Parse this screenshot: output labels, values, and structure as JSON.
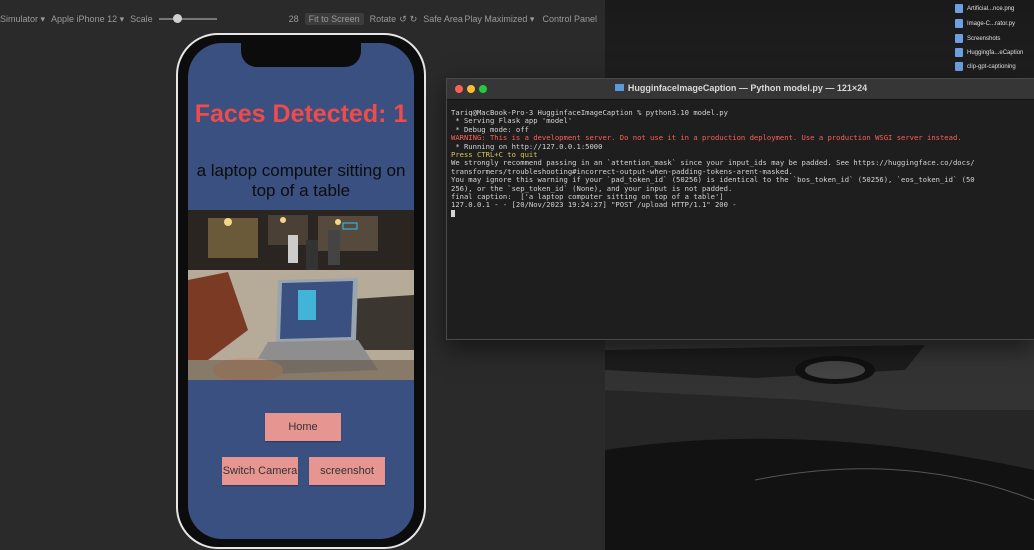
{
  "editor_toolbar": {
    "simulator_label": "Simulator ▾",
    "device_label": "Apple iPhone 12 ▾",
    "scale_label": "Scale",
    "scale_value": "28",
    "fit_label": "Fit to Screen",
    "rotate_label": "Rotate",
    "safe_area_label": "Safe Area",
    "play_mode_label": "Play Maximized ▾",
    "control_panel_label": "Control Panel"
  },
  "app": {
    "faces_title": "Faces Detected: 1",
    "caption": "a laptop computer sitting on top of a table",
    "buttons": {
      "home": "Home",
      "switch_camera": "Switch Camera",
      "screenshot": "screenshot"
    }
  },
  "terminal": {
    "title": "HugginfaceImageCaption — Python model.py — 121×24",
    "lines": [
      {
        "text": "Tariq@MacBook-Pro-3 HugginfaceImageCaption % python3.10 model.py",
        "kind": "normal"
      },
      {
        "text": " * Serving Flask app 'model'",
        "kind": "normal"
      },
      {
        "text": " * Debug mode: off",
        "kind": "normal"
      },
      {
        "text": "WARNING: This is a development server. Do not use it in a production deployment. Use a production WSGI server instead.",
        "kind": "warn"
      },
      {
        "text": " * Running on http://127.0.0.1:5000",
        "kind": "normal"
      },
      {
        "text": "Press CTRL+C to quit",
        "kind": "ok"
      },
      {
        "text": "",
        "kind": "normal"
      },
      {
        "text": "",
        "kind": "normal"
      },
      {
        "text": "We strongly recommend passing in an `attention_mask` since your input_ids may be padded. See https://huggingface.co/docs/",
        "kind": "normal"
      },
      {
        "text": "transformers/troubleshooting#incorrect-output-when-padding-tokens-arent-masked.",
        "kind": "normal"
      },
      {
        "text": "You may ignore this warning if your `pad_token_id` (50256) is identical to the `bos_token_id` (50256), `eos_token_id` (50",
        "kind": "normal"
      },
      {
        "text": "256), or the `sep_token_id` (None), and your input is not padded.",
        "kind": "normal"
      },
      {
        "text": "final caption:  ['a laptop computer sitting on top of a table']",
        "kind": "normal"
      },
      {
        "text": "127.0.0.1 - - [20/Nov/2023 19:24:27] \"POST /upload HTTP/1.1\" 200 -",
        "kind": "normal"
      }
    ]
  },
  "finder_items": [
    {
      "label": "Artificial...nce.png"
    },
    {
      "label": "Image-C...rator.py"
    },
    {
      "label": "Screenshots"
    },
    {
      "label": "Huggingfa...eCaption"
    },
    {
      "label": "clip-gpt-captioning"
    }
  ],
  "colors": {
    "title_red": "#ef4b4b",
    "screen_blue": "#3a5080",
    "button_pink": "#e69591",
    "terminal_bg": "#1e1e1e",
    "warn_red": "#ff5f56",
    "ok_yellow": "#d7c75a"
  }
}
